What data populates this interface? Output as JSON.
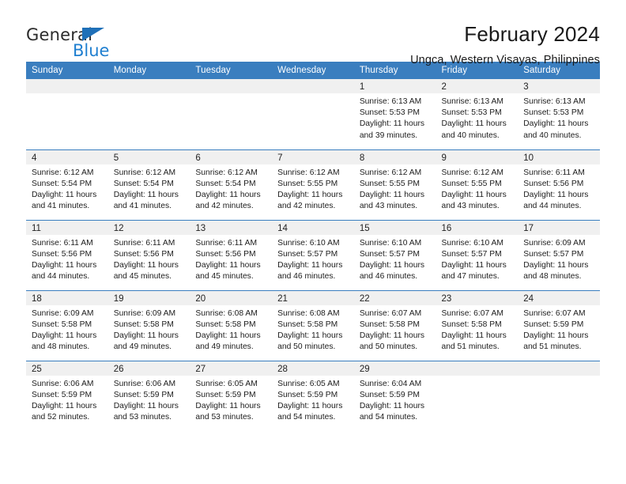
{
  "brand": {
    "name_top": "General",
    "name_bottom": "Blue",
    "triangle_color": "#1f70b8",
    "blue_text_color": "#1f7fd0"
  },
  "header": {
    "title": "February 2024",
    "subtitle": "Ungca, Western Visayas, Philippines"
  },
  "theme": {
    "header_blue": "#3a7ebf",
    "daynum_band": "#f0f0f0",
    "text": "#1c1c1c"
  },
  "weekday_headers": [
    "Sunday",
    "Monday",
    "Tuesday",
    "Wednesday",
    "Thursday",
    "Friday",
    "Saturday"
  ],
  "weeks": [
    [
      {
        "day": "",
        "sunrise": "",
        "sunset": "",
        "daylight": "",
        "daylight2": ""
      },
      {
        "day": "",
        "sunrise": "",
        "sunset": "",
        "daylight": "",
        "daylight2": ""
      },
      {
        "day": "",
        "sunrise": "",
        "sunset": "",
        "daylight": "",
        "daylight2": ""
      },
      {
        "day": "",
        "sunrise": "",
        "sunset": "",
        "daylight": "",
        "daylight2": ""
      },
      {
        "day": "1",
        "sunrise": "Sunrise: 6:13 AM",
        "sunset": "Sunset: 5:53 PM",
        "daylight": "Daylight: 11 hours",
        "daylight2": "and 39 minutes."
      },
      {
        "day": "2",
        "sunrise": "Sunrise: 6:13 AM",
        "sunset": "Sunset: 5:53 PM",
        "daylight": "Daylight: 11 hours",
        "daylight2": "and 40 minutes."
      },
      {
        "day": "3",
        "sunrise": "Sunrise: 6:13 AM",
        "sunset": "Sunset: 5:53 PM",
        "daylight": "Daylight: 11 hours",
        "daylight2": "and 40 minutes."
      }
    ],
    [
      {
        "day": "4",
        "sunrise": "Sunrise: 6:12 AM",
        "sunset": "Sunset: 5:54 PM",
        "daylight": "Daylight: 11 hours",
        "daylight2": "and 41 minutes."
      },
      {
        "day": "5",
        "sunrise": "Sunrise: 6:12 AM",
        "sunset": "Sunset: 5:54 PM",
        "daylight": "Daylight: 11 hours",
        "daylight2": "and 41 minutes."
      },
      {
        "day": "6",
        "sunrise": "Sunrise: 6:12 AM",
        "sunset": "Sunset: 5:54 PM",
        "daylight": "Daylight: 11 hours",
        "daylight2": "and 42 minutes."
      },
      {
        "day": "7",
        "sunrise": "Sunrise: 6:12 AM",
        "sunset": "Sunset: 5:55 PM",
        "daylight": "Daylight: 11 hours",
        "daylight2": "and 42 minutes."
      },
      {
        "day": "8",
        "sunrise": "Sunrise: 6:12 AM",
        "sunset": "Sunset: 5:55 PM",
        "daylight": "Daylight: 11 hours",
        "daylight2": "and 43 minutes."
      },
      {
        "day": "9",
        "sunrise": "Sunrise: 6:12 AM",
        "sunset": "Sunset: 5:55 PM",
        "daylight": "Daylight: 11 hours",
        "daylight2": "and 43 minutes."
      },
      {
        "day": "10",
        "sunrise": "Sunrise: 6:11 AM",
        "sunset": "Sunset: 5:56 PM",
        "daylight": "Daylight: 11 hours",
        "daylight2": "and 44 minutes."
      }
    ],
    [
      {
        "day": "11",
        "sunrise": "Sunrise: 6:11 AM",
        "sunset": "Sunset: 5:56 PM",
        "daylight": "Daylight: 11 hours",
        "daylight2": "and 44 minutes."
      },
      {
        "day": "12",
        "sunrise": "Sunrise: 6:11 AM",
        "sunset": "Sunset: 5:56 PM",
        "daylight": "Daylight: 11 hours",
        "daylight2": "and 45 minutes."
      },
      {
        "day": "13",
        "sunrise": "Sunrise: 6:11 AM",
        "sunset": "Sunset: 5:56 PM",
        "daylight": "Daylight: 11 hours",
        "daylight2": "and 45 minutes."
      },
      {
        "day": "14",
        "sunrise": "Sunrise: 6:10 AM",
        "sunset": "Sunset: 5:57 PM",
        "daylight": "Daylight: 11 hours",
        "daylight2": "and 46 minutes."
      },
      {
        "day": "15",
        "sunrise": "Sunrise: 6:10 AM",
        "sunset": "Sunset: 5:57 PM",
        "daylight": "Daylight: 11 hours",
        "daylight2": "and 46 minutes."
      },
      {
        "day": "16",
        "sunrise": "Sunrise: 6:10 AM",
        "sunset": "Sunset: 5:57 PM",
        "daylight": "Daylight: 11 hours",
        "daylight2": "and 47 minutes."
      },
      {
        "day": "17",
        "sunrise": "Sunrise: 6:09 AM",
        "sunset": "Sunset: 5:57 PM",
        "daylight": "Daylight: 11 hours",
        "daylight2": "and 48 minutes."
      }
    ],
    [
      {
        "day": "18",
        "sunrise": "Sunrise: 6:09 AM",
        "sunset": "Sunset: 5:58 PM",
        "daylight": "Daylight: 11 hours",
        "daylight2": "and 48 minutes."
      },
      {
        "day": "19",
        "sunrise": "Sunrise: 6:09 AM",
        "sunset": "Sunset: 5:58 PM",
        "daylight": "Daylight: 11 hours",
        "daylight2": "and 49 minutes."
      },
      {
        "day": "20",
        "sunrise": "Sunrise: 6:08 AM",
        "sunset": "Sunset: 5:58 PM",
        "daylight": "Daylight: 11 hours",
        "daylight2": "and 49 minutes."
      },
      {
        "day": "21",
        "sunrise": "Sunrise: 6:08 AM",
        "sunset": "Sunset: 5:58 PM",
        "daylight": "Daylight: 11 hours",
        "daylight2": "and 50 minutes."
      },
      {
        "day": "22",
        "sunrise": "Sunrise: 6:07 AM",
        "sunset": "Sunset: 5:58 PM",
        "daylight": "Daylight: 11 hours",
        "daylight2": "and 50 minutes."
      },
      {
        "day": "23",
        "sunrise": "Sunrise: 6:07 AM",
        "sunset": "Sunset: 5:58 PM",
        "daylight": "Daylight: 11 hours",
        "daylight2": "and 51 minutes."
      },
      {
        "day": "24",
        "sunrise": "Sunrise: 6:07 AM",
        "sunset": "Sunset: 5:59 PM",
        "daylight": "Daylight: 11 hours",
        "daylight2": "and 51 minutes."
      }
    ],
    [
      {
        "day": "25",
        "sunrise": "Sunrise: 6:06 AM",
        "sunset": "Sunset: 5:59 PM",
        "daylight": "Daylight: 11 hours",
        "daylight2": "and 52 minutes."
      },
      {
        "day": "26",
        "sunrise": "Sunrise: 6:06 AM",
        "sunset": "Sunset: 5:59 PM",
        "daylight": "Daylight: 11 hours",
        "daylight2": "and 53 minutes."
      },
      {
        "day": "27",
        "sunrise": "Sunrise: 6:05 AM",
        "sunset": "Sunset: 5:59 PM",
        "daylight": "Daylight: 11 hours",
        "daylight2": "and 53 minutes."
      },
      {
        "day": "28",
        "sunrise": "Sunrise: 6:05 AM",
        "sunset": "Sunset: 5:59 PM",
        "daylight": "Daylight: 11 hours",
        "daylight2": "and 54 minutes."
      },
      {
        "day": "29",
        "sunrise": "Sunrise: 6:04 AM",
        "sunset": "Sunset: 5:59 PM",
        "daylight": "Daylight: 11 hours",
        "daylight2": "and 54 minutes."
      },
      {
        "day": "",
        "sunrise": "",
        "sunset": "",
        "daylight": "",
        "daylight2": ""
      },
      {
        "day": "",
        "sunrise": "",
        "sunset": "",
        "daylight": "",
        "daylight2": ""
      }
    ]
  ]
}
